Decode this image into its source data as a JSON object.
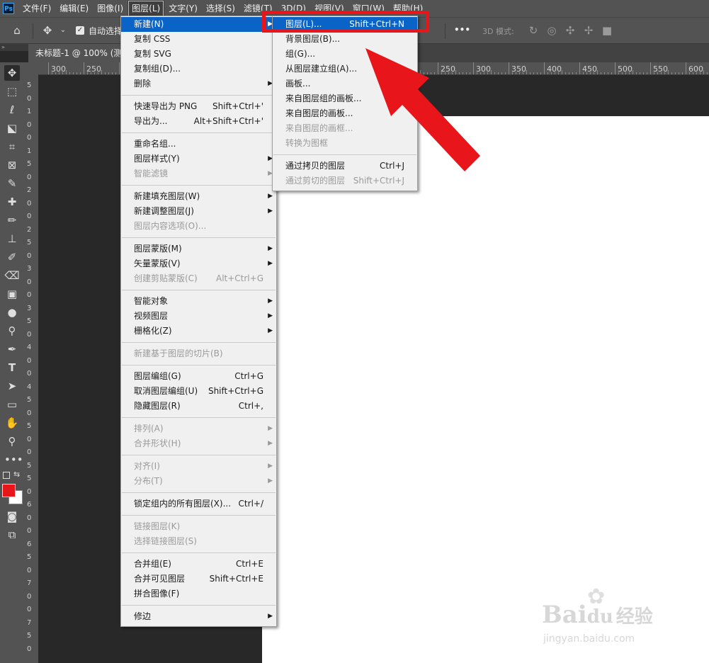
{
  "menubar": {
    "logo": "Ps",
    "items": [
      "文件(F)",
      "编辑(E)",
      "图像(I)",
      "图层(L)",
      "文字(Y)",
      "选择(S)",
      "滤镜(T)",
      "3D(D)",
      "视图(V)",
      "窗口(W)",
      "帮助(H)"
    ]
  },
  "options": {
    "auto_select_label": "自动选择",
    "more": "•••",
    "mode_3d_label": "3D 模式:"
  },
  "document_tab": {
    "title": "未标题-1 @ 100% (测量"
  },
  "ruler": {
    "top_labels": [
      "300",
      "250",
      "250",
      "300",
      "350",
      "400",
      "450",
      "500",
      "550",
      "600"
    ],
    "left_labels": [
      "5",
      "0",
      "1",
      "0",
      "0",
      "1",
      "5",
      "0",
      "2",
      "0",
      "0",
      "2",
      "5",
      "0",
      "3",
      "0",
      "0",
      "3",
      "5",
      "0",
      "4",
      "0",
      "0",
      "4",
      "5",
      "0",
      "5",
      "0",
      "0",
      "5",
      "5",
      "0",
      "6",
      "0",
      "0",
      "6",
      "5",
      "0",
      "7",
      "0",
      "0",
      "7",
      "5",
      "0"
    ]
  },
  "layer_menu": {
    "groups": [
      [
        {
          "label": "新建(N)",
          "shortcut": "",
          "submenu": true,
          "disabled": false,
          "highlight": true
        },
        {
          "label": "复制 CSS",
          "shortcut": "",
          "submenu": false,
          "disabled": false
        },
        {
          "label": "复制 SVG",
          "shortcut": "",
          "submenu": false,
          "disabled": false
        },
        {
          "label": "复制组(D)...",
          "shortcut": "",
          "submenu": false,
          "disabled": false
        },
        {
          "label": "删除",
          "shortcut": "",
          "submenu": true,
          "disabled": false
        }
      ],
      [
        {
          "label": "快速导出为 PNG",
          "shortcut": "Shift+Ctrl+'",
          "submenu": false,
          "disabled": false
        },
        {
          "label": "导出为...",
          "shortcut": "Alt+Shift+Ctrl+'",
          "submenu": false,
          "disabled": false
        }
      ],
      [
        {
          "label": "重命名组...",
          "shortcut": "",
          "submenu": false,
          "disabled": false
        },
        {
          "label": "图层样式(Y)",
          "shortcut": "",
          "submenu": true,
          "disabled": false
        },
        {
          "label": "智能滤镜",
          "shortcut": "",
          "submenu": true,
          "disabled": true
        }
      ],
      [
        {
          "label": "新建填充图层(W)",
          "shortcut": "",
          "submenu": true,
          "disabled": false
        },
        {
          "label": "新建调整图层(J)",
          "shortcut": "",
          "submenu": true,
          "disabled": false
        },
        {
          "label": "图层内容选项(O)...",
          "shortcut": "",
          "submenu": false,
          "disabled": true
        }
      ],
      [
        {
          "label": "图层蒙版(M)",
          "shortcut": "",
          "submenu": true,
          "disabled": false
        },
        {
          "label": "矢量蒙版(V)",
          "shortcut": "",
          "submenu": true,
          "disabled": false
        },
        {
          "label": "创建剪贴蒙版(C)",
          "shortcut": "Alt+Ctrl+G",
          "submenu": false,
          "disabled": true
        }
      ],
      [
        {
          "label": "智能对象",
          "shortcut": "",
          "submenu": true,
          "disabled": false
        },
        {
          "label": "视频图层",
          "shortcut": "",
          "submenu": true,
          "disabled": false
        },
        {
          "label": "栅格化(Z)",
          "shortcut": "",
          "submenu": true,
          "disabled": false
        }
      ],
      [
        {
          "label": "新建基于图层的切片(B)",
          "shortcut": "",
          "submenu": false,
          "disabled": true
        }
      ],
      [
        {
          "label": "图层编组(G)",
          "shortcut": "Ctrl+G",
          "submenu": false,
          "disabled": false
        },
        {
          "label": "取消图层编组(U)",
          "shortcut": "Shift+Ctrl+G",
          "submenu": false,
          "disabled": false
        },
        {
          "label": "隐藏图层(R)",
          "shortcut": "Ctrl+,",
          "submenu": false,
          "disabled": false
        }
      ],
      [
        {
          "label": "排列(A)",
          "shortcut": "",
          "submenu": true,
          "disabled": true
        },
        {
          "label": "合并形状(H)",
          "shortcut": "",
          "submenu": true,
          "disabled": true
        }
      ],
      [
        {
          "label": "对齐(I)",
          "shortcut": "",
          "submenu": true,
          "disabled": true
        },
        {
          "label": "分布(T)",
          "shortcut": "",
          "submenu": true,
          "disabled": true
        }
      ],
      [
        {
          "label": "锁定组内的所有图层(X)...",
          "shortcut": "Ctrl+/",
          "submenu": false,
          "disabled": false
        }
      ],
      [
        {
          "label": "链接图层(K)",
          "shortcut": "",
          "submenu": false,
          "disabled": true
        },
        {
          "label": "选择链接图层(S)",
          "shortcut": "",
          "submenu": false,
          "disabled": true
        }
      ],
      [
        {
          "label": "合并组(E)",
          "shortcut": "Ctrl+E",
          "submenu": false,
          "disabled": false
        },
        {
          "label": "合并可见图层",
          "shortcut": "Shift+Ctrl+E",
          "submenu": false,
          "disabled": false
        },
        {
          "label": "拼合图像(F)",
          "shortcut": "",
          "submenu": false,
          "disabled": false
        }
      ],
      [
        {
          "label": "修边",
          "shortcut": "",
          "submenu": true,
          "disabled": false
        }
      ]
    ]
  },
  "new_submenu": {
    "groups": [
      [
        {
          "label": "图层(L)...",
          "shortcut": "Shift+Ctrl+N",
          "disabled": false,
          "highlight": true
        },
        {
          "label": "背景图层(B)...",
          "shortcut": "",
          "disabled": false
        },
        {
          "label": "组(G)...",
          "shortcut": "",
          "disabled": false
        },
        {
          "label": "从图层建立组(A)...",
          "shortcut": "",
          "disabled": false
        },
        {
          "label": "画板...",
          "shortcut": "",
          "disabled": false
        },
        {
          "label": "来自图层组的画板...",
          "shortcut": "",
          "disabled": false
        },
        {
          "label": "来自图层的画板...",
          "shortcut": "",
          "disabled": false
        },
        {
          "label": "来自图层的画框...",
          "shortcut": "",
          "disabled": true
        },
        {
          "label": "转换为图框",
          "shortcut": "",
          "disabled": true
        }
      ],
      [
        {
          "label": "通过拷贝的图层",
          "shortcut": "Ctrl+J",
          "disabled": false
        },
        {
          "label": "通过剪切的图层",
          "shortcut": "Shift+Ctrl+J",
          "disabled": true
        }
      ]
    ]
  },
  "colors": {
    "foreground": "#e8161b",
    "background": "#ffffff",
    "highlight": "#0a64c8",
    "annotation": "#e8161b"
  },
  "watermark": {
    "brand": "Bai",
    "brand2": "du",
    "cn": "经验",
    "url": "jingyan.baidu.com"
  }
}
